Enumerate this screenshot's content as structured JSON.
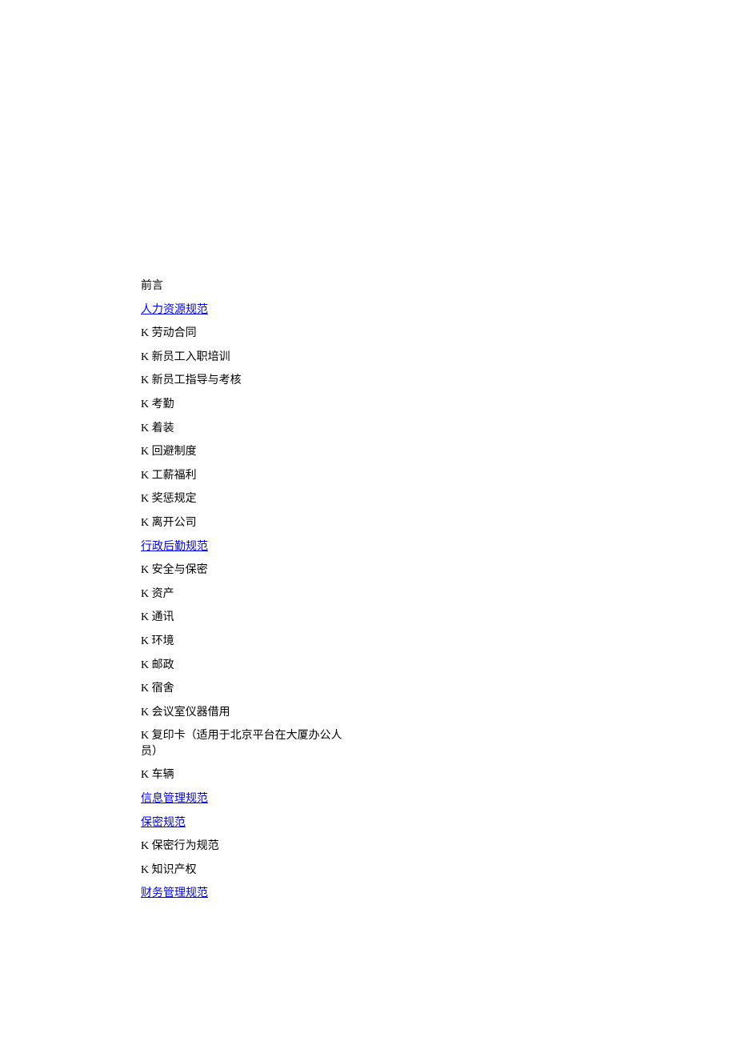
{
  "toc": {
    "items": [
      {
        "type": "plain",
        "text": "前言"
      },
      {
        "type": "link",
        "text": "人力资源规范"
      },
      {
        "type": "plain",
        "text": "K 劳动合同"
      },
      {
        "type": "plain",
        "text": "K 新员工入职培训"
      },
      {
        "type": "plain",
        "text": "K 新员工指导与考核"
      },
      {
        "type": "plain",
        "text": "K 考勤"
      },
      {
        "type": "plain",
        "text": "K 着装"
      },
      {
        "type": "plain",
        "text": "K 回避制度"
      },
      {
        "type": "plain",
        "text": "K 工薪福利"
      },
      {
        "type": "plain",
        "text": "K 奖惩规定"
      },
      {
        "type": "plain",
        "text": "K 离开公司"
      },
      {
        "type": "link",
        "text": "行政后勤规范"
      },
      {
        "type": "plain",
        "text": "K 安全与保密"
      },
      {
        "type": "plain",
        "text": "K 资产"
      },
      {
        "type": "plain",
        "text": "K 通讯"
      },
      {
        "type": "plain",
        "text": "K 环境"
      },
      {
        "type": "plain",
        "text": "K 邮政"
      },
      {
        "type": "plain",
        "text": "K 宿舍"
      },
      {
        "type": "plain",
        "text": "K 会议室仪器借用"
      },
      {
        "type": "plain",
        "text": "K 复印卡（适用于北京平台在大厦办公人员）"
      },
      {
        "type": "plain",
        "text": "K 车辆"
      },
      {
        "type": "link",
        "text": "信息管理规范"
      },
      {
        "type": "link",
        "text": "保密规范"
      },
      {
        "type": "plain",
        "text": "K 保密行为规范"
      },
      {
        "type": "plain",
        "text": "K 知识产权"
      },
      {
        "type": "link",
        "text": "财务管理规范"
      }
    ]
  }
}
